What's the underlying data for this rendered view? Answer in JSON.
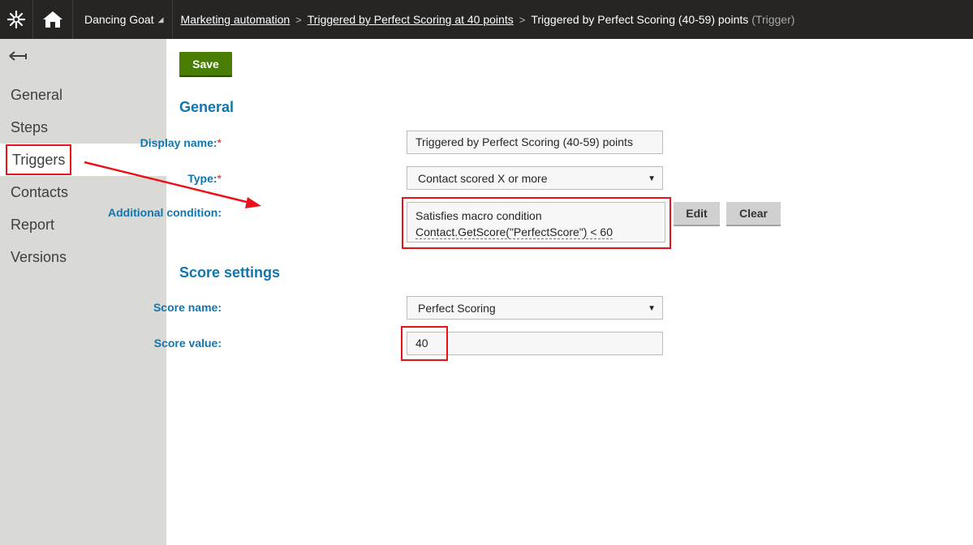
{
  "topbar": {
    "site_name": "Dancing Goat",
    "breadcrumbs": [
      "Marketing automation",
      "Triggered by Perfect Scoring at 40 points"
    ],
    "current": "Triggered by Perfect Scoring (40-59) points",
    "current_type": "(Trigger)"
  },
  "sidebar": {
    "items": [
      {
        "label": "General"
      },
      {
        "label": "Steps"
      },
      {
        "label": "Triggers"
      },
      {
        "label": "Contacts"
      },
      {
        "label": "Report"
      },
      {
        "label": "Versions"
      }
    ],
    "active_item": "Triggers"
  },
  "toolbar": {
    "save_label": "Save"
  },
  "general": {
    "title": "General",
    "display_name": {
      "label": "Display name:",
      "required_marker": "*",
      "value": "Triggered by Perfect Scoring (40-59) points"
    },
    "type": {
      "label": "Type:",
      "required_marker": "*",
      "value": "Contact scored X or more"
    },
    "additional_condition": {
      "label": "Additional condition:",
      "line1": "Satisfies macro condition",
      "line2": "Contact.GetScore(\"PerfectScore\") < 60",
      "edit_label": "Edit",
      "clear_label": "Clear"
    }
  },
  "score_settings": {
    "title": "Score settings",
    "score_name": {
      "label": "Score name:",
      "value": "Perfect Scoring"
    },
    "score_value": {
      "label": "Score value:",
      "value": "40"
    }
  },
  "colors": {
    "topbar_bg": "#262524",
    "sidebar_bg": "#d9d9d6",
    "accent_blue": "#1175ae",
    "save_green": "#497d04",
    "highlight_red": "#e8131a"
  }
}
